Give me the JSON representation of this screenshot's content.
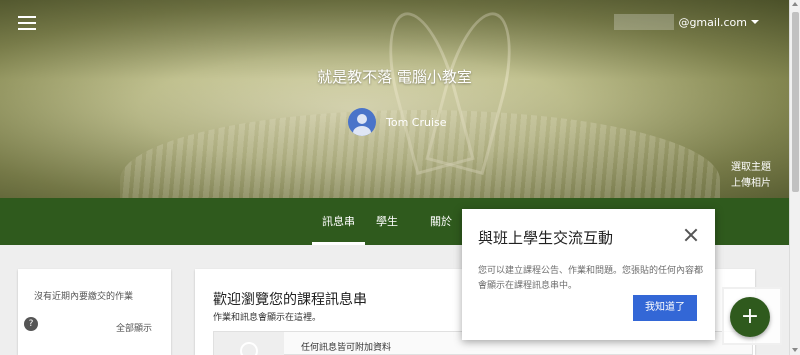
{
  "header": {
    "menu_icon": "hamburger-menu-icon",
    "account_email": "@gmail.com",
    "class_title": "就是教不落 電腦小教室",
    "teacher_name": "Tom Cruise",
    "select_theme_label": "選取主題",
    "upload_photo_label": "上傳相片"
  },
  "tabs": [
    {
      "label": "訊息串",
      "active": true
    },
    {
      "label": "學生",
      "active": false
    },
    {
      "label": "關於",
      "active": false
    }
  ],
  "upcoming": {
    "no_work_text": "沒有近期內要繳交的作業",
    "view_all_label": "全部顯示",
    "help_icon": "?"
  },
  "stream": {
    "title": "歡迎瀏覽您的課程訊息串",
    "subtitle": "作業和訊息會顯示在這裡。",
    "attach_text": "任何訊息皆可附加資料"
  },
  "dialog": {
    "title": "與班上學生交流互動",
    "body": "您可以建立課程公告、作業和問題。您張貼的任何內容都會顯示在課程訊息串中。",
    "button_label": "我知道了",
    "close_icon": "close-icon"
  },
  "fab": {
    "label": "+"
  },
  "colors": {
    "theme_green": "#2f5a1d",
    "button_blue": "#3367d6"
  }
}
